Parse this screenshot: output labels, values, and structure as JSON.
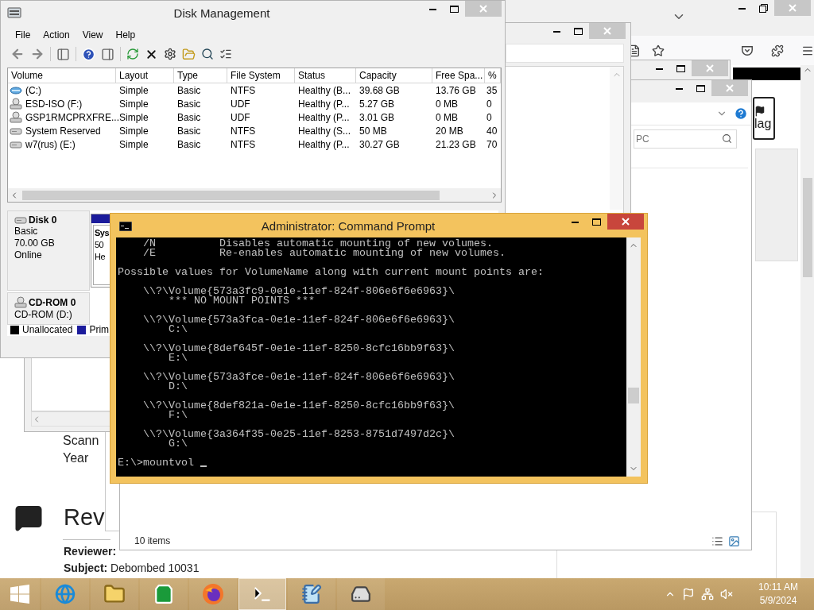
{
  "browser": {
    "page": {
      "scan_text": "Scann",
      "year_text": "Year",
      "reviews_heading": "Rev",
      "reviewer_label": "Reviewer:",
      "subject": "**Subject:** Debombed 10031",
      "flag_button": "lag"
    }
  },
  "explorer": {
    "search": {
      "placeholder": "PC"
    },
    "status": "10 items"
  },
  "disk_management": {
    "title": "Disk Management",
    "menu": [
      "File",
      "Action",
      "View",
      "Help"
    ],
    "columns": [
      "Volume",
      "Layout",
      "Type",
      "File System",
      "Status",
      "Capacity",
      "Free Spa...",
      "%"
    ],
    "rows": [
      {
        "kind": "boot",
        "volume": "(C:)",
        "layout": "Simple",
        "type": "Basic",
        "file_system": "NTFS",
        "status": "Healthy (B...",
        "capacity": "39.68 GB",
        "free_space": "13.76 GB",
        "percent_free": "35"
      },
      {
        "kind": "optical",
        "volume": "ESD-ISO (F:)",
        "layout": "Simple",
        "type": "Basic",
        "file_system": "UDF",
        "status": "Healthy (P...",
        "capacity": "5.27 GB",
        "free_space": "0 MB",
        "percent_free": "0"
      },
      {
        "kind": "optical",
        "volume": "GSP1RMCPRXFRE...",
        "layout": "Simple",
        "type": "Basic",
        "file_system": "UDF",
        "status": "Healthy (P...",
        "capacity": "3.01 GB",
        "free_space": "0 MB",
        "percent_free": "0"
      },
      {
        "kind": "disk",
        "volume": "System Reserved",
        "layout": "Simple",
        "type": "Basic",
        "file_system": "NTFS",
        "status": "Healthy (S...",
        "capacity": "50 MB",
        "free_space": "20 MB",
        "percent_free": "40"
      },
      {
        "kind": "disk",
        "volume": "w7(rus) (E:)",
        "layout": "Simple",
        "type": "Basic",
        "file_system": "NTFS",
        "status": "Healthy (P...",
        "capacity": "30.27 GB",
        "free_space": "21.23 GB",
        "percent_free": "70"
      }
    ],
    "disks": [
      {
        "kind": "disk",
        "name": "Disk 0",
        "details": [
          "Basic",
          "70.00 GB",
          "Online"
        ],
        "partition": {
          "kind": "primary",
          "lines": [
            "Sys",
            "50",
            "He"
          ]
        }
      },
      {
        "kind": "optical",
        "name": "CD-ROM 0",
        "details": [
          "CD-ROM (D:)"
        ]
      }
    ],
    "legend": [
      {
        "kind": "unallocated",
        "label": "Unallocated",
        "color": "#000000"
      },
      {
        "kind": "primary",
        "label": "Prim",
        "color": "#1c1c9c"
      }
    ]
  },
  "command_prompt": {
    "title": "Administrator: Command Prompt",
    "blocks": [
      [
        "    /N          Disables automatic mounting of new volumes.",
        "    /E          Re-enables automatic mounting of new volumes."
      ],
      [
        "Possible values for VolumeName along with current mount points are:"
      ],
      [
        "    \\\\?\\Volume{573a3fc9-0e1e-11ef-824f-806e6f6e6963}\\",
        "        *** NO MOUNT POINTS ***"
      ],
      [
        "    \\\\?\\Volume{573a3fca-0e1e-11ef-824f-806e6f6e6963}\\",
        "        C:\\"
      ],
      [
        "    \\\\?\\Volume{8def645f-0e1e-11ef-8250-8cfc16bb9f63}\\",
        "        E:\\"
      ],
      [
        "    \\\\?\\Volume{573a3fce-0e1e-11ef-824f-806e6f6e6963}\\",
        "        D:\\"
      ],
      [
        "    \\\\?\\Volume{8def821a-0e1e-11ef-8250-8cfc16bb9f63}\\",
        "        F:\\"
      ],
      [
        "    \\\\?\\Volume{3a364f35-0e25-11ef-8253-8751d7497d2c}\\",
        "        G:\\"
      ]
    ],
    "prompt": "E:\\>mountvol "
  },
  "taskbar": {
    "items": [
      {
        "kind": "start",
        "selected": false
      },
      {
        "kind": "web-browser",
        "selected": false
      },
      {
        "kind": "files",
        "selected": false
      },
      {
        "kind": "store",
        "selected": false
      },
      {
        "kind": "firefox",
        "selected": false
      },
      {
        "kind": "console",
        "selected": true
      },
      {
        "kind": "notepad",
        "selected": false
      },
      {
        "kind": "disk-tool",
        "selected": false
      }
    ],
    "time": "10:11 AM",
    "date": "5/9/2024"
  }
}
